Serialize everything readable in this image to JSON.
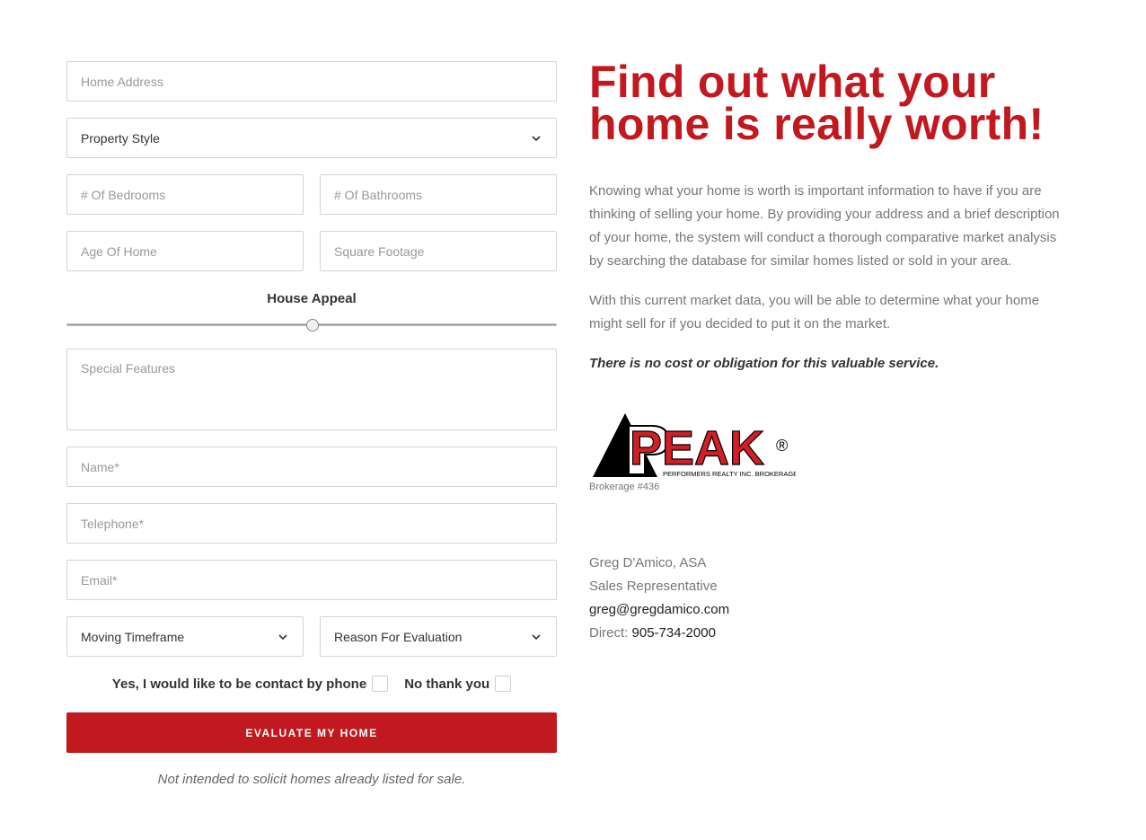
{
  "form": {
    "home_address_placeholder": "Home Address",
    "property_style_label": "Property Style",
    "bedrooms_placeholder": "# Of Bedrooms",
    "bathrooms_placeholder": "# Of Bathrooms",
    "age_placeholder": "Age Of Home",
    "sqft_placeholder": "Square Footage",
    "house_appeal_label": "House Appeal",
    "house_appeal_value": 0.5,
    "special_features_placeholder": "Special Features",
    "name_placeholder": "Name*",
    "telephone_placeholder": "Telephone*",
    "email_placeholder": "Email*",
    "moving_timeframe_label": "Moving Timeframe",
    "reason_label": "Reason For Evaluation",
    "contact_yes_label": "Yes, I would like to be contact by phone",
    "contact_no_label": "No thank you",
    "submit_label": "EVALUATE MY HOME",
    "disclaimer": "Not intended to solicit homes already listed for sale."
  },
  "content": {
    "headline": "Find out what your home is really worth!",
    "paragraph1": "Knowing what your home is worth is important information to have if you are thinking of selling your home. By providing your address and a brief description of your home, the system will conduct a thorough comparative market analysis by searching the database for similar homes listed or sold in your area.",
    "paragraph2": "With this current market data, you will be able to determine what your home might sell for if you decided to put it on the market.",
    "emphasis": "There is no cost or obligation for this valuable service."
  },
  "logo": {
    "text": "PEAK",
    "registered": "®",
    "tagline": "PERFORMERS REALTY INC. BROKERAGE",
    "brokerage": "Brokerage #436"
  },
  "agent": {
    "name": "Greg D'Amico, ASA",
    "title": "Sales Representative",
    "email": "greg@gregdamico.com",
    "direct_label": "Direct:",
    "direct_phone": "905-734-2000"
  },
  "colors": {
    "brand_red": "#c1191f"
  }
}
